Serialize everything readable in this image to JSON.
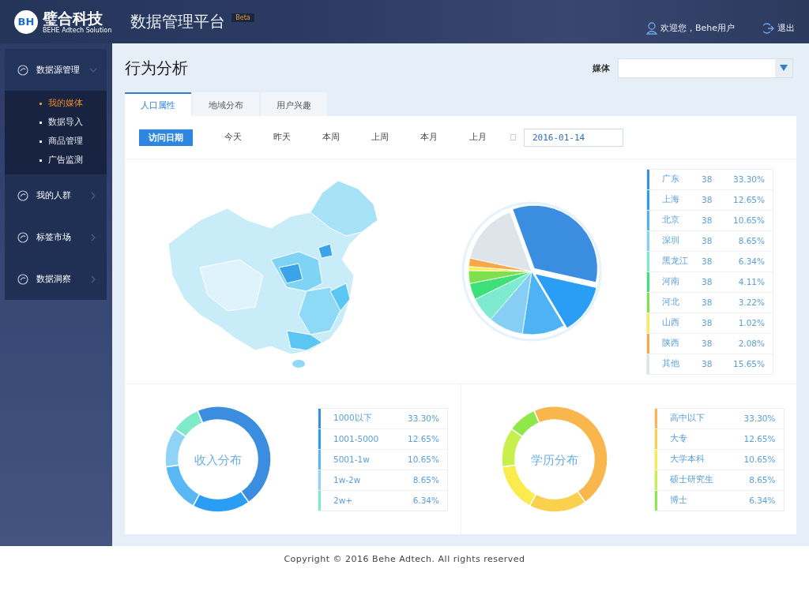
{
  "header": {
    "logo_mark": "BH",
    "logo_name": "璧合科技",
    "logo_tagline": "BEHE Adtech Solution",
    "app_title": "数据管理平台",
    "badge": "Beta",
    "welcome": "欢迎您，Behe用户",
    "logout": "退出"
  },
  "sidebar": {
    "groups": [
      {
        "label": "数据源管理",
        "expanded": true,
        "children": [
          {
            "label": "我的媒体",
            "selected": true
          },
          {
            "label": "数据导入",
            "selected": false
          },
          {
            "label": "商品管理",
            "selected": false
          },
          {
            "label": "广告监测",
            "selected": false
          }
        ]
      },
      {
        "label": "我的人群",
        "expanded": false
      },
      {
        "label": "标签市场",
        "expanded": false
      },
      {
        "label": "数据洞察",
        "expanded": false
      }
    ]
  },
  "page": {
    "title": "行为分析",
    "media_filter": {
      "label": "媒体"
    }
  },
  "tabs": [
    {
      "label": "人口属性",
      "selected": true
    },
    {
      "label": "地域分布",
      "selected": false
    },
    {
      "label": "用户兴趣",
      "selected": false
    }
  ],
  "date_filter": {
    "label": "访问日期",
    "options": [
      "今天",
      "昨天",
      "本周",
      "上周",
      "本月",
      "上月"
    ],
    "date": "2016-01-14"
  },
  "region_chart": {
    "kind": "pie",
    "legend": [
      {
        "name": "广东",
        "count": "38",
        "share": "33.30%",
        "color": "#3b8de0"
      },
      {
        "name": "上海",
        "count": "38",
        "share": "12.65%",
        "color": "#2a9df4"
      },
      {
        "name": "北京",
        "count": "38",
        "share": "10.65%",
        "color": "#4db3f5"
      },
      {
        "name": "深圳",
        "count": "38",
        "share": "8.65%",
        "color": "#87cef5"
      },
      {
        "name": "黑龙江",
        "count": "38",
        "share": "6.34%",
        "color": "#7eead0"
      },
      {
        "name": "河南",
        "count": "38",
        "share": "4.11%",
        "color": "#3ee07a"
      },
      {
        "name": "河北",
        "count": "38",
        "share": "3.22%",
        "color": "#7ee04a"
      },
      {
        "name": "山西",
        "count": "38",
        "share": "1.02%",
        "color": "#f7ef50"
      },
      {
        "name": "陕西",
        "count": "38",
        "share": "2.08%",
        "color": "#f7a94a"
      },
      {
        "name": "其他",
        "count": "38",
        "share": "15.65%",
        "color": "#dde4ea"
      }
    ]
  },
  "income_chart": {
    "kind": "donut",
    "title": "收入分布",
    "legend": [
      {
        "name": "1000以下",
        "share": "33.30%",
        "color": "#3b8de0"
      },
      {
        "name": "1001-5000",
        "share": "12.65%",
        "color": "#2a9df4"
      },
      {
        "name": "5001-1w",
        "share": "10.65%",
        "color": "#5ab7f5"
      },
      {
        "name": "1w-2w",
        "share": "8.65%",
        "color": "#8fd3f7"
      },
      {
        "name": "2w+",
        "share": "6.34%",
        "color": "#7eeac8"
      }
    ]
  },
  "education_chart": {
    "kind": "donut",
    "title": "学历分布",
    "legend": [
      {
        "name": "高中以下",
        "share": "33.30%",
        "color": "#f8b64c"
      },
      {
        "name": "大专",
        "share": "12.65%",
        "color": "#f9d14c"
      },
      {
        "name": "大学本科",
        "share": "10.65%",
        "color": "#f9ec4c"
      },
      {
        "name": "硕士研究生",
        "share": "8.65%",
        "color": "#c8f04c"
      },
      {
        "name": "博士",
        "share": "6.34%",
        "color": "#8ee84a"
      }
    ]
  },
  "footer": {
    "copyright": "Copyright © 2016 Behe Adtech. All rights reserved"
  }
}
